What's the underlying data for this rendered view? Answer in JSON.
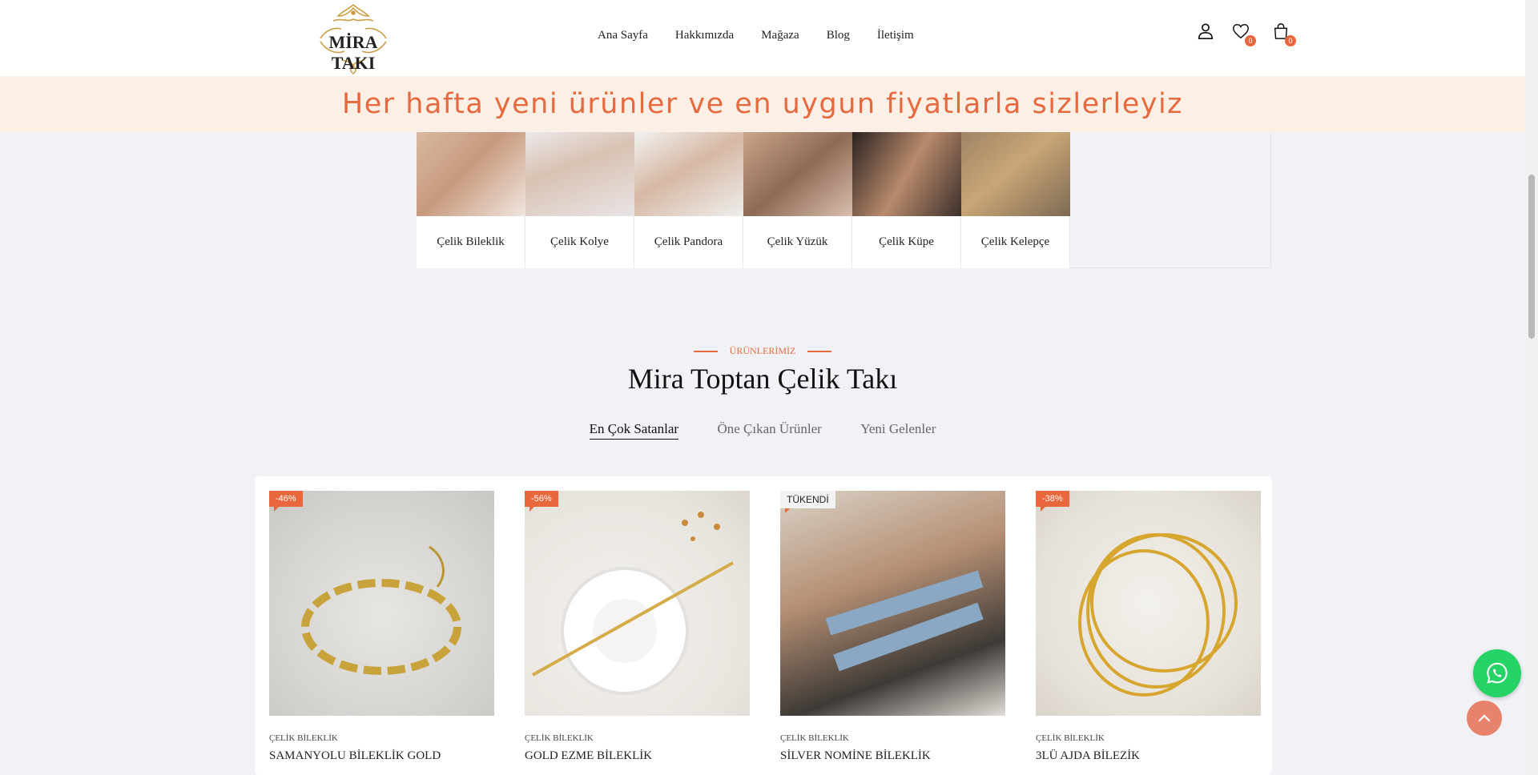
{
  "header": {
    "logo_text": "MİRA TAKI",
    "logo_icon": "ornament-logo",
    "nav": [
      "Ana Sayfa",
      "Hakkımızda",
      "Mağaza",
      "Blog",
      "İletişim"
    ],
    "icons": {
      "account": "user-icon",
      "wishlist": "heart-icon",
      "cart": "bag-icon"
    },
    "wishlist_count": "0",
    "cart_count": "0"
  },
  "banner": {
    "text": "Her hafta yeni ürünler ve en uygun fiyatlarla sizlerleyiz"
  },
  "categories": [
    {
      "label": "Çelik Bileklik"
    },
    {
      "label": "Çelik Kolye"
    },
    {
      "label": "Çelik Pandora"
    },
    {
      "label": "Çelik Yüzük"
    },
    {
      "label": "Çelik Küpe"
    },
    {
      "label": "Çelik Kelepçe"
    }
  ],
  "section": {
    "eyebrow": "ÜRÜNLERİMİZ",
    "title": "Mira Toptan Çelik Takı",
    "tabs": [
      "En Çok Satanlar",
      "Öne Çıkan Ürünler",
      "Yeni Gelenler"
    ],
    "active_tab": "En Çok Satanlar"
  },
  "products": [
    {
      "badge": "-46%",
      "category": "ÇELİK BİLEKLİK",
      "name": "SAMANYOLU BİLEKLİK GOLD"
    },
    {
      "badge": "-56%",
      "category": "ÇELİK BİLEKLİK",
      "name": "GOLD EZME BİLEKLİK"
    },
    {
      "badge": "TÜKENDİ",
      "category": "ÇELİK BİLEKLİK",
      "name": "SİLVER NOMİNE BİLEKLİK"
    },
    {
      "badge": "-38%",
      "category": "ÇELİK BİLEKLİK",
      "name": "3LÜ AJDA BİLEZİK"
    }
  ],
  "floating": {
    "whatsapp": "whatsapp-icon",
    "back_to_top": "chevron-up-icon"
  },
  "colors": {
    "accent": "#e8673c",
    "banner_bg": "#fcf0e6",
    "page_bg": "#f1f2f6",
    "whatsapp": "#25d366"
  }
}
